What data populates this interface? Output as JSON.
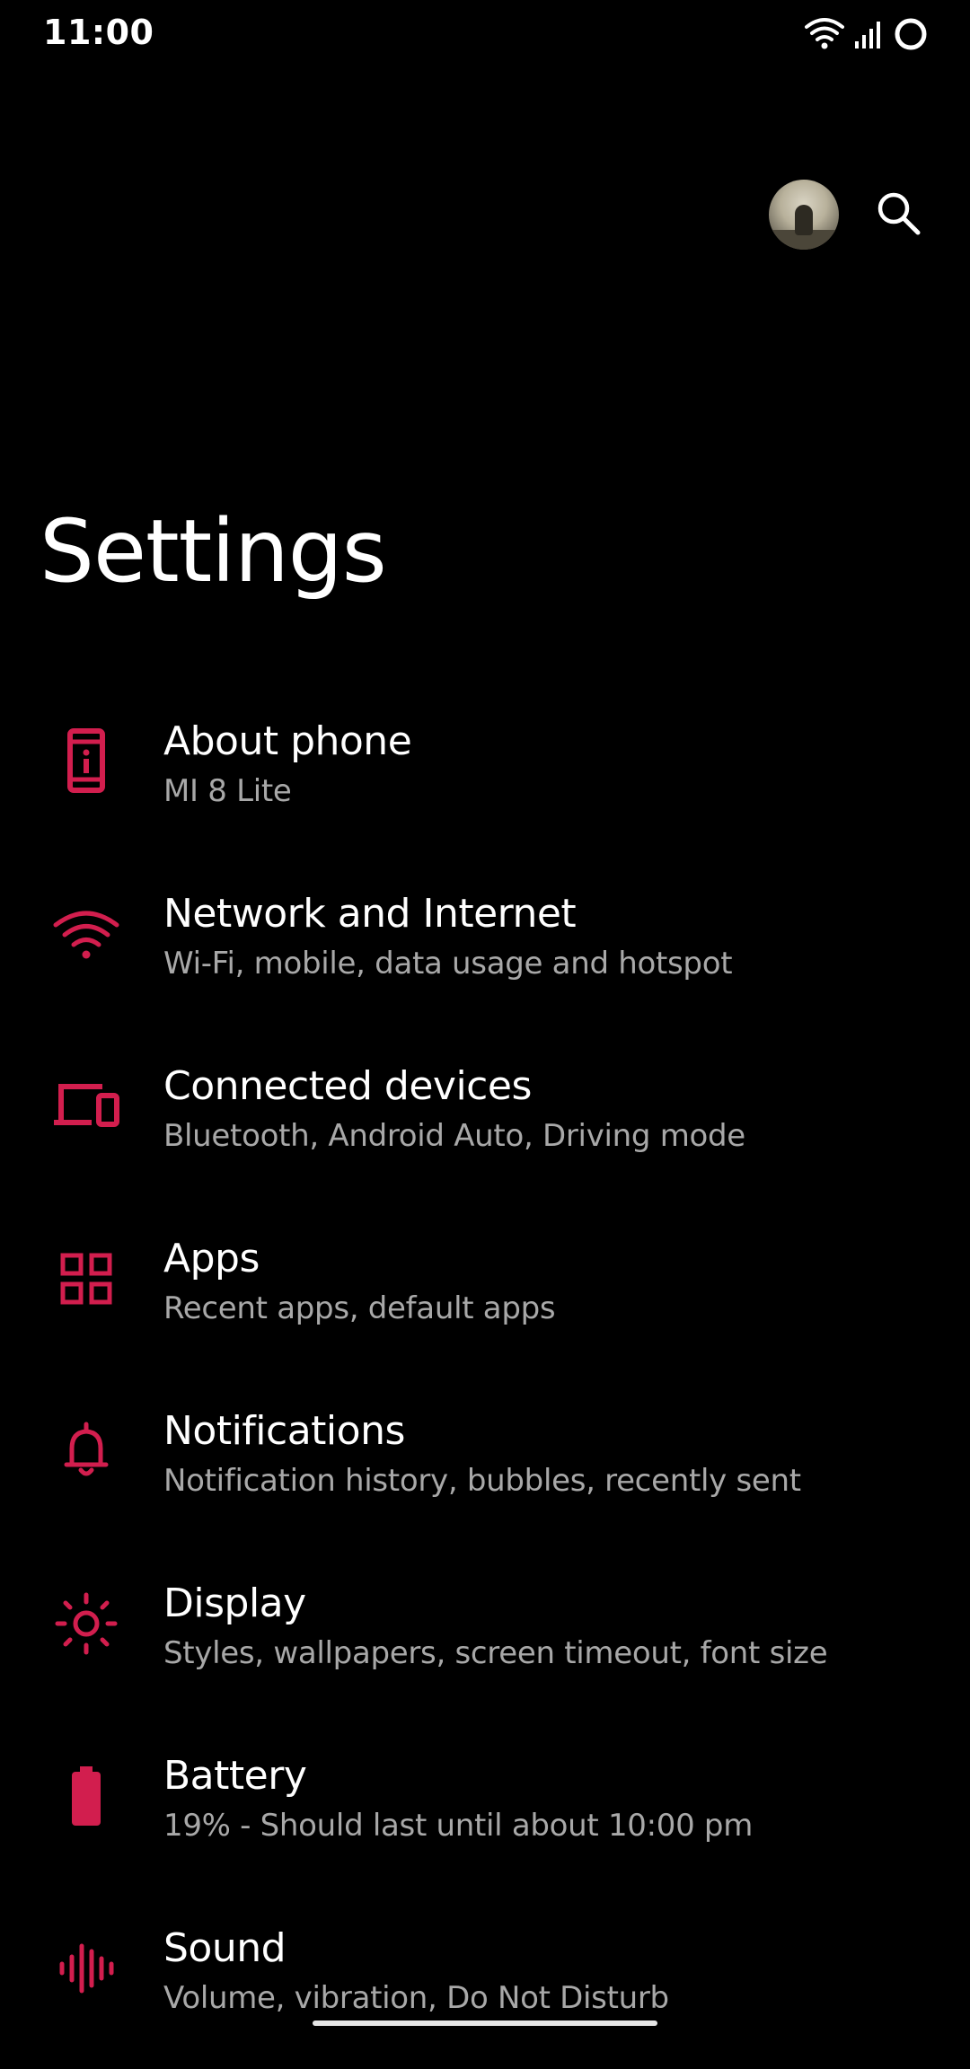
{
  "status_bar": {
    "time": "11:00"
  },
  "header": {
    "title": "Settings"
  },
  "accent_color": "#d21e4e",
  "settings": [
    {
      "title": "About phone",
      "summary": "MI 8 Lite",
      "icon": "phone-info-icon"
    },
    {
      "title": "Network and Internet",
      "summary": "Wi-Fi, mobile, data usage and hotspot",
      "icon": "wifi-icon"
    },
    {
      "title": "Connected devices",
      "summary": "Bluetooth, Android Auto, Driving mode",
      "icon": "devices-icon"
    },
    {
      "title": "Apps",
      "summary": "Recent apps, default apps",
      "icon": "apps-grid-icon"
    },
    {
      "title": "Notifications",
      "summary": "Notification history, bubbles, recently sent",
      "icon": "bell-icon"
    },
    {
      "title": "Display",
      "summary": "Styles, wallpapers, screen timeout, font size",
      "icon": "brightness-icon"
    },
    {
      "title": "Battery",
      "summary": "19% - Should last until about 10:00 pm",
      "icon": "battery-icon"
    },
    {
      "title": "Sound",
      "summary": "Volume, vibration, Do Not Disturb",
      "icon": "sound-wave-icon"
    }
  ]
}
